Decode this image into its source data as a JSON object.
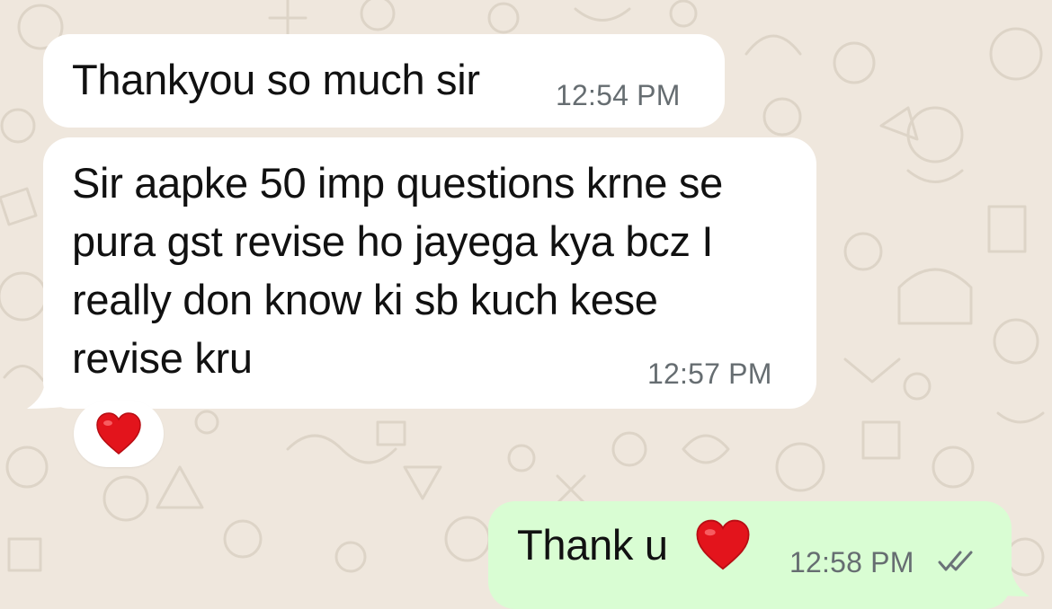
{
  "chat": {
    "messages": [
      {
        "direction": "incoming",
        "text": "Thankyou so much sir",
        "time": "12:54 PM"
      },
      {
        "direction": "incoming",
        "text": "Sir aapke 50 imp questions krne se\npura gst revise ho jayega kya bcz I\nreally don know ki sb kuch kese\nrevise kru",
        "time": "12:57 PM",
        "reaction": "heart"
      },
      {
        "direction": "outgoing",
        "text": "Thank u",
        "emoji": "heart",
        "time": "12:58 PM",
        "status": "read"
      }
    ]
  },
  "colors": {
    "wallpaper": "#efe7dd",
    "incoming_bubble": "#ffffff",
    "outgoing_bubble": "#d9fdd3",
    "timestamp": "#666d71",
    "read_ticks": "#6b7378",
    "heart": "#e3141c"
  }
}
